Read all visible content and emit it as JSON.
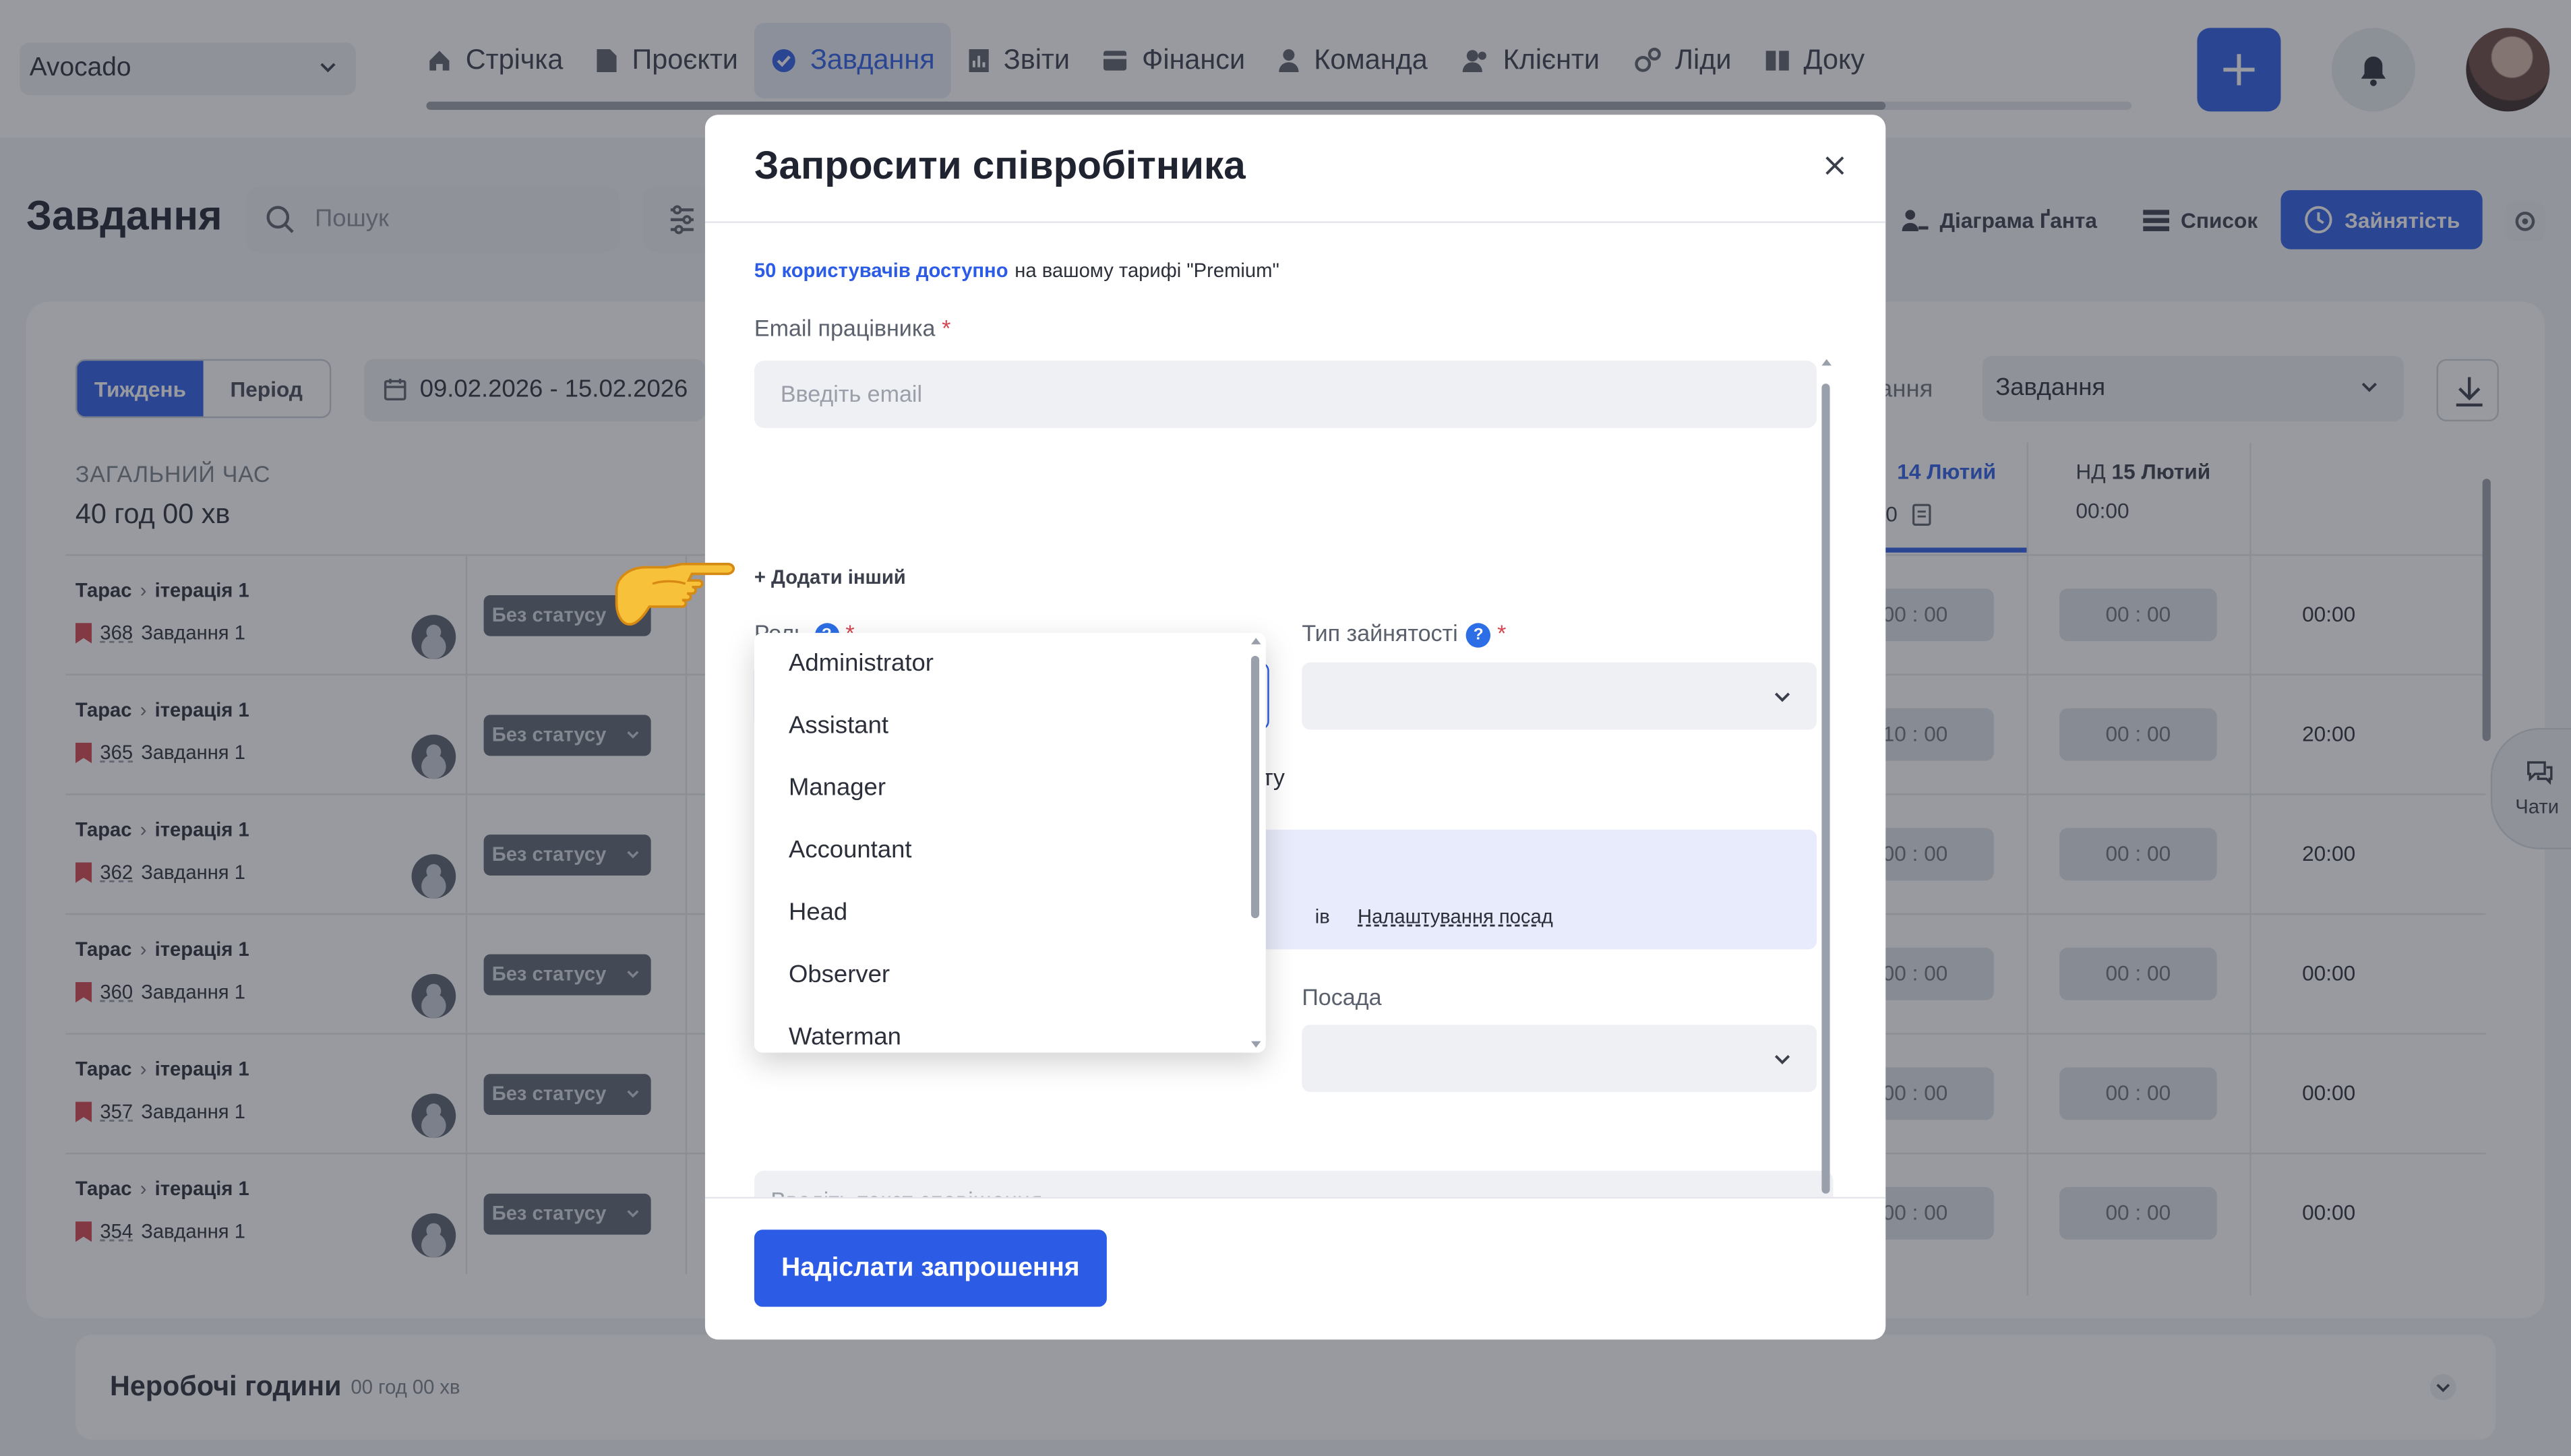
{
  "topbar": {
    "workspace": "Avocado",
    "nav": [
      {
        "label": "Стрічка",
        "icon": "home-icon"
      },
      {
        "label": "Проєкти",
        "icon": "document-icon"
      },
      {
        "label": "Завдання",
        "icon": "check-circle-icon",
        "active": true
      },
      {
        "label": "Звіти",
        "icon": "report-icon"
      },
      {
        "label": "Фінанси",
        "icon": "wallet-icon"
      },
      {
        "label": "Команда",
        "icon": "person-icon"
      },
      {
        "label": "Клієнти",
        "icon": "people-icon"
      },
      {
        "label": "Ліди",
        "icon": "leads-icon"
      },
      {
        "label": "Доку",
        "icon": "book-icon"
      }
    ]
  },
  "page": {
    "title": "Завдання",
    "search_placeholder": "Пошук",
    "view_tabs": [
      {
        "label": "Діаграма Ґанта",
        "icon": "gantt-icon"
      },
      {
        "label": "Список",
        "icon": "list-icon"
      },
      {
        "label": "Зайнятість",
        "icon": "clock-icon",
        "active": true
      }
    ]
  },
  "workload": {
    "period_tabs": [
      "Тиждень",
      "Період"
    ],
    "date_range": "09.02.2026 - 15.02.2026",
    "group_label": "вання",
    "group_value": "Завдання",
    "total_label": "ЗАГАЛЬНИЙ ЧАС",
    "total_value": "40 год 00 хв",
    "days": [
      {
        "prefix": "",
        "date": "14 Лютий"
      },
      {
        "prefix": "НД",
        "date": "15 Лютий"
      }
    ],
    "day_totals": [
      "0",
      "00:00"
    ],
    "status_label": "Без статусу",
    "rows": [
      {
        "user": "Тарас",
        "iteration": "ітерація 1",
        "num": "368",
        "task": "Завдання 1",
        "c1": "00 : 00",
        "c2": "00 : 00",
        "total": "00:00"
      },
      {
        "user": "Тарас",
        "iteration": "ітерація 1",
        "num": "365",
        "task": "Завдання 1",
        "c1": "10 : 00",
        "c2": "00 : 00",
        "total": "20:00"
      },
      {
        "user": "Тарас",
        "iteration": "ітерація 1",
        "num": "362",
        "task": "Завдання 1",
        "c1": "00 : 00",
        "c2": "00 : 00",
        "total": "20:00"
      },
      {
        "user": "Тарас",
        "iteration": "ітерація 1",
        "num": "360",
        "task": "Завдання 1",
        "c1": "00 : 00",
        "c2": "00 : 00",
        "total": "00:00"
      },
      {
        "user": "Тарас",
        "iteration": "ітерація 1",
        "num": "357",
        "task": "Завдання 1",
        "c1": "00 : 00",
        "c2": "00 : 00",
        "total": "00:00"
      },
      {
        "user": "Тарас",
        "iteration": "ітерація 1",
        "num": "354",
        "task": "Завдання 1",
        "c1": "00 : 00",
        "c2": "00 : 00",
        "total": "00:00"
      }
    ],
    "nonwork_title": "Неробочі години",
    "nonwork_value": "00 год 00 хв",
    "chat_label": "Чати"
  },
  "modal": {
    "title": "Запросити співробітника",
    "available_link": "50 користувачів доступно",
    "available_text": "на вашому тарифі \"Premium\"",
    "email_label": "Email працівника",
    "email_placeholder": "Введіть email",
    "add_other": "+ Додати інший",
    "role_label": "Роль",
    "employment_label": "Тип зайнятості",
    "role_fragment": "ту",
    "info_fragment": "ів",
    "positions_link": "Налаштування посад",
    "position_label": "Посада",
    "message_placeholder": "Введіть текст сповіщення",
    "send_button": "Надіслати запрошення",
    "role_options": [
      "Administrator",
      "Assistant",
      "Manager",
      "Accountant",
      "Head",
      "Observer",
      "Waterman"
    ]
  },
  "colors": {
    "accent": "#2c5ce6",
    "required": "#d64550",
    "status_badge": "#5f6573"
  }
}
